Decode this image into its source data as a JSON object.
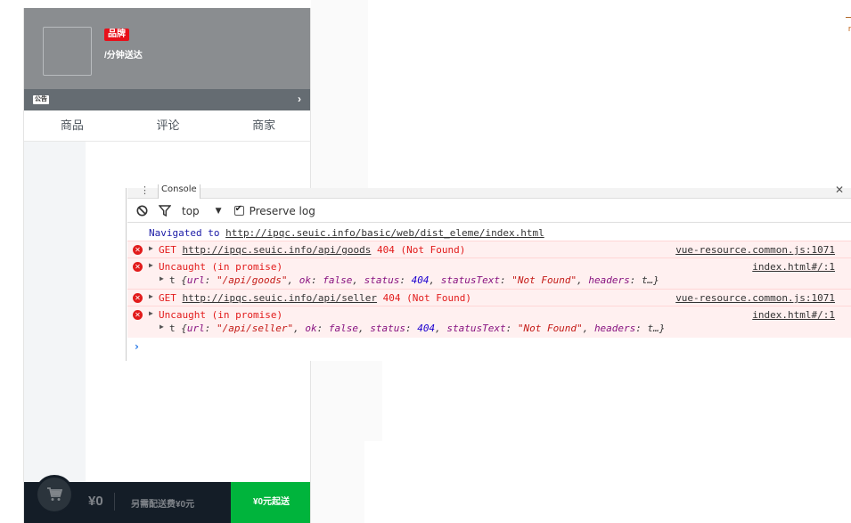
{
  "app": {
    "brand_badge": "品牌",
    "delivery_text": "/分钟送达",
    "bulletin_tag": "公告",
    "bulletin_arrow": "›",
    "tabs": [
      {
        "label": "商品"
      },
      {
        "label": "评论"
      },
      {
        "label": "商家"
      }
    ],
    "cart": {
      "total_price": "¥0",
      "extra_fee": "另需配送费¥0元",
      "pay_label": "¥0元起送"
    },
    "colors": {
      "header_bg": "#8a8d90",
      "brand_red": "#e8101a",
      "cart_bg": "#141d27",
      "pay_green": "#00b43c"
    }
  },
  "stray_text": "r",
  "devtools": {
    "tab_more": "⋮",
    "console_tab": "Console",
    "close": "✕",
    "toolbar": {
      "context": "top",
      "context_arrow": "▼",
      "preserve_log_label": "Preserve log",
      "preserve_log_checked": true
    },
    "messages": {
      "nav_prefix": "Navigated to ",
      "nav_url": "http://ipqc.seuic.info/basic/web/dist_eleme/index.html",
      "m1": {
        "method": "GET ",
        "url": "http://ipqc.seuic.info/api/goods",
        "status": " 404 (Not Found)",
        "source": "vue-resource.common.js:1071"
      },
      "m2": {
        "text": "Uncaught (in promise)",
        "source": "index.html#/:1",
        "obj_t": "t ",
        "obj_open": "{",
        "url_key": "url",
        "url_val": "\"/api/goods\"",
        "ok_key": "ok",
        "ok_val": "false",
        "status_key": "status",
        "status_val": "404",
        "statusText_key": "statusText",
        "statusText_val": "\"Not Found\"",
        "headers_key": "headers",
        "headers_val": "t…}"
      },
      "m3": {
        "method": "GET ",
        "url": "http://ipqc.seuic.info/api/seller",
        "status": " 404 (Not Found)",
        "source": "vue-resource.common.js:1071"
      },
      "m4": {
        "text": "Uncaught (in promise)",
        "source": "index.html#/:1",
        "obj_t": "t ",
        "obj_open": "{",
        "url_key": "url",
        "url_val": "\"/api/seller\"",
        "ok_key": "ok",
        "ok_val": "false",
        "status_key": "status",
        "status_val": "404",
        "statusText_key": "statusText",
        "statusText_val": "\"Not Found\"",
        "headers_key": "headers",
        "headers_val": "t…}"
      },
      "prompt": "›"
    }
  }
}
